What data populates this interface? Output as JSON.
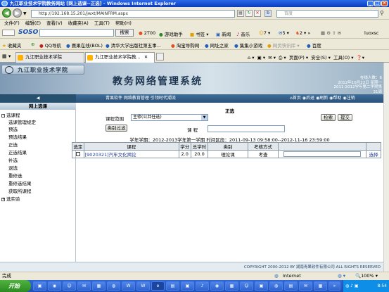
{
  "window": {
    "title": "九江职业技术学院教务网站 [网上选课--正选] - Windows Internet Explorer"
  },
  "address": {
    "url": "http://192.168.15.201/jwxt/MAINFRM.aspx",
    "search_placeholder": "百度"
  },
  "menu": [
    "文件(F)",
    "编辑(E)",
    "查看(V)",
    "收藏夹(A)",
    "工具(T)",
    "帮助(H)"
  ],
  "soso": {
    "logo": "SOSO",
    "search_button": "搜索",
    "items": [
      "2T00",
      "游戏助手",
      "书签",
      "新闻",
      "音乐",
      "7",
      "5",
      "2",
      "luoxsc"
    ]
  },
  "favorites": {
    "label": "收藏夹",
    "items": [
      "QQ导航",
      "赛果在线(BOL)",
      "清华大学出版社第五事...",
      "淘宝导购网",
      "网址之家",
      "集集小游戏",
      "网页快讯库",
      "百度"
    ]
  },
  "tabs": [
    {
      "label": "九江职业技术学院",
      "active": false
    },
    {
      "label": "九江职业技术学院教...",
      "active": true
    }
  ],
  "tab_tools": [
    "页面(P)",
    "安全(S)",
    "工具(O)"
  ],
  "banner": {
    "school_name": "九江职业技术学院",
    "system_title": "教务网络管理系统",
    "online": "在线人数：6",
    "date": "2012年10月22日 星期一",
    "week": "2011-2012学年第二学期第31周"
  },
  "navbar": {
    "marquee": "青果软件  网络教育管理  引领时代潮流",
    "links": [
      "首页",
      "后退",
      "刷新",
      "帮助",
      "注销"
    ]
  },
  "sidebar": {
    "title": "网上选课",
    "items": [
      {
        "label": "选课程",
        "level": 0,
        "box": "-"
      },
      {
        "label": "选课管理规定",
        "level": 1
      },
      {
        "label": "预选",
        "level": 1
      },
      {
        "label": "预选结果",
        "level": 1
      },
      {
        "label": "正选",
        "level": 1
      },
      {
        "label": "正选结果",
        "level": 1
      },
      {
        "label": "补选",
        "level": 1
      },
      {
        "label": "退选",
        "level": 1
      },
      {
        "label": "重修选",
        "level": 1
      },
      {
        "label": "重修选结果",
        "level": 1
      },
      {
        "label": "获取所课程",
        "level": 1
      },
      {
        "label": "选实验",
        "level": 0,
        "box": "+"
      }
    ]
  },
  "main": {
    "page_title": "正选",
    "range_label": "课程范围",
    "range_value": "主修(公共任选)",
    "search_button": "检索",
    "submit_button": "提交",
    "filter_button": "类别过滤",
    "course_label": "课    程",
    "course_value": "",
    "semester_text": "学年学期：2012-2013学年第一学期  时间区段：2011-09-13 09:58:00--2012-11-16 23:59:00",
    "table": {
      "headers": [
        "选定",
        "课程",
        "学分",
        "总学时",
        "类别",
        "考核方式",
        "",
        ""
      ],
      "rows": [
        {
          "selected": false,
          "course": "[9020321]汽车文化揭论",
          "credit": "2.0",
          "hours": "20.0",
          "category": "理论课",
          "exam": "考查",
          "action": "选择"
        }
      ]
    },
    "footer": "COPYRIGHT 2000-2012 BY 湖南青果软件有限公司 ALL RIGHTS RESERVED"
  },
  "statusbar": {
    "left": "完成",
    "zone": "Internet",
    "zoom": "100%"
  },
  "taskbar": {
    "start": "开始",
    "clock": "8:54"
  }
}
